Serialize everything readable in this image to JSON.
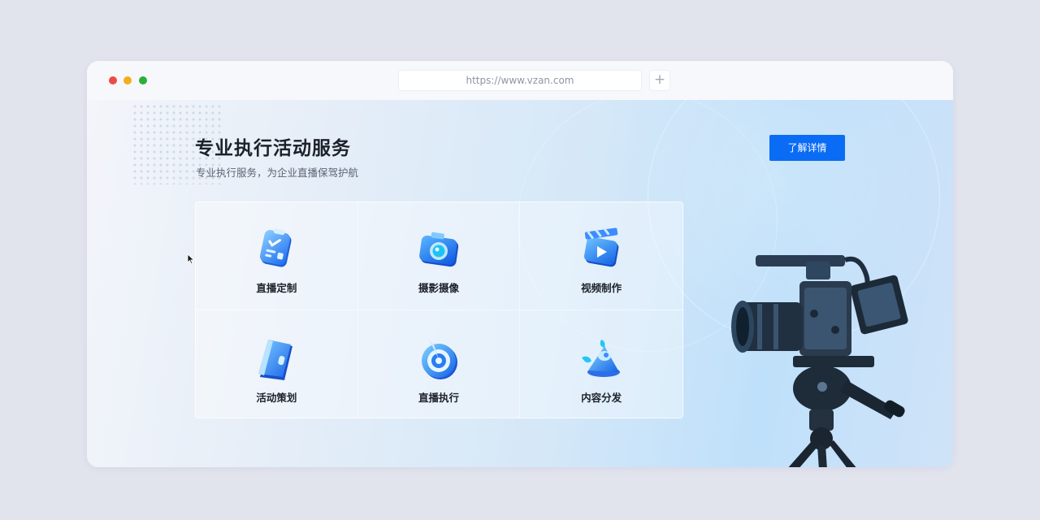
{
  "browser": {
    "url": "https://www.vzan.com",
    "new_tab": "+"
  },
  "hero": {
    "title": "专业执行活动服务",
    "subtitle": "专业执行服务，为企业直播保驾护航",
    "cta_label": "了解详情"
  },
  "services": [
    {
      "label": "直播定制",
      "icon": "clipboard-icon"
    },
    {
      "label": "摄影摄像",
      "icon": "camera-icon"
    },
    {
      "label": "视频制作",
      "icon": "video-clapper-icon"
    },
    {
      "label": "活动策划",
      "icon": "notebook-icon"
    },
    {
      "label": "直播执行",
      "icon": "target-icon"
    },
    {
      "label": "内容分发",
      "icon": "share-cone-icon"
    }
  ],
  "colors": {
    "accent": "#0a6cf5",
    "title": "#1d2129",
    "page_bg": "#e1e3ed"
  }
}
